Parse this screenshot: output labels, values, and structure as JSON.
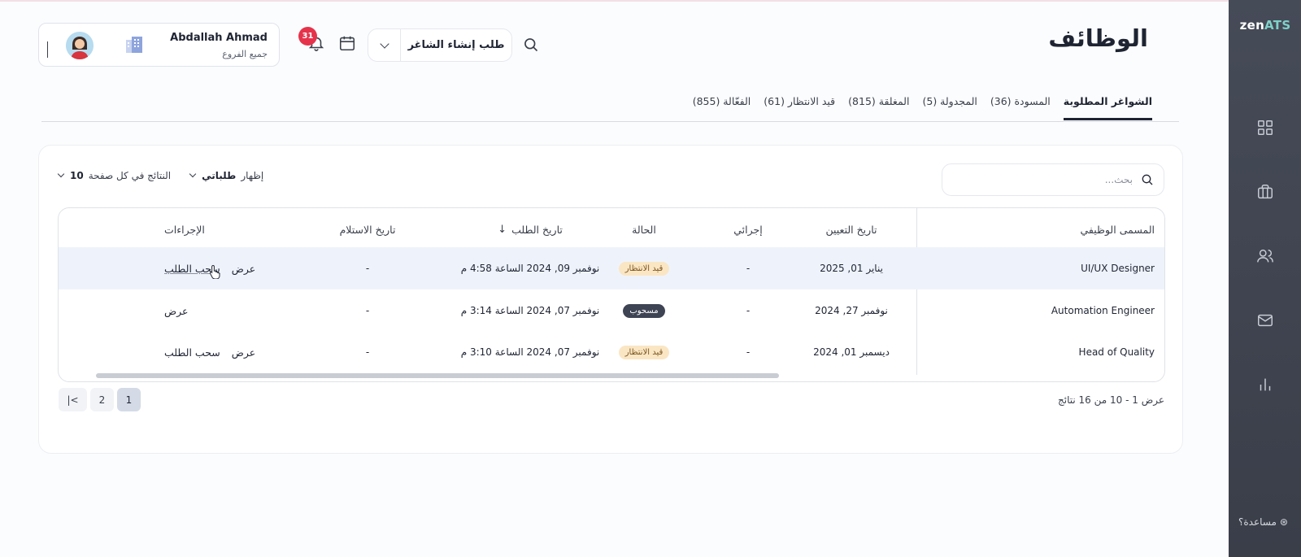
{
  "app": {
    "logo_main": "zen",
    "logo_accent": "ATS",
    "help_label": "مساعدة؟"
  },
  "header": {
    "title": "الوظائف",
    "create_button_label": "طلب إنشاء الشاغر",
    "notification_count": "31",
    "user": {
      "name": "Abdallah Ahmad",
      "branch": "جميع الفروع"
    }
  },
  "tabs": [
    {
      "label": "الفعّالة (855)",
      "active": false
    },
    {
      "label": "قيد الانتظار (61)",
      "active": false
    },
    {
      "label": "المغلقة (815)",
      "active": false
    },
    {
      "label": "المجدولة (5)",
      "active": false
    },
    {
      "label": "المسودة (36)",
      "active": false
    },
    {
      "label": "الشواغر المطلوبة",
      "active": true
    }
  ],
  "toolbar": {
    "search_placeholder": "بحث...",
    "show_label": "إظهار",
    "show_value": "طلباتي",
    "per_page_label": "النتائج في كل صفحة",
    "per_page_value": "10"
  },
  "table": {
    "headers": {
      "title": "المسمى الوظيفي",
      "assign_date": "تاريخ التعيين",
      "my_action": "إجرائي",
      "status": "الحالة",
      "request_date": "تاريخ الطلب",
      "receive_date": "تاريخ الاستلام",
      "actions": "الإجراءات"
    },
    "rows": [
      {
        "title": "UI/UX Designer",
        "assign_date": "يناير 01, 2025",
        "my_action": "-",
        "status": "قيد الانتظار",
        "status_kind": "pending",
        "request_date": "نوفمبر 09, 2024 الساعة 4:58 م",
        "receive_date": "-",
        "view": "عرض",
        "withdraw": "سحب الطلب"
      },
      {
        "title": "Automation Engineer",
        "assign_date": "نوفمبر 27, 2024",
        "my_action": "-",
        "status": "مسحوب",
        "status_kind": "withdrawn",
        "request_date": "نوفمبر 07, 2024 الساعة 3:14 م",
        "receive_date": "-",
        "view": "عرض",
        "withdraw": ""
      },
      {
        "title": "Head of Quality",
        "assign_date": "ديسمبر 01, 2024",
        "my_action": "-",
        "status": "قيد الانتظار",
        "status_kind": "pending",
        "request_date": "نوفمبر 07, 2024 الساعة 3:10 م",
        "receive_date": "-",
        "view": "عرض",
        "withdraw": "سحب الطلب"
      }
    ]
  },
  "pagination": {
    "first_label": "|<",
    "pages": [
      "1",
      "2"
    ],
    "current": "1",
    "summary": "عرض 1 - 10 من 16 نتائج"
  },
  "colors": {
    "sidebar": "#464b58",
    "badge": "#e5334b",
    "pending_bg": "#fbe6c4",
    "withdrawn_bg": "#3e4454",
    "selected_row": "#eef3fb"
  },
  "icons": {
    "sidebar": [
      "grid-icon",
      "briefcase-icon",
      "users-icon",
      "mail-icon",
      "bar-chart-icon"
    ]
  }
}
